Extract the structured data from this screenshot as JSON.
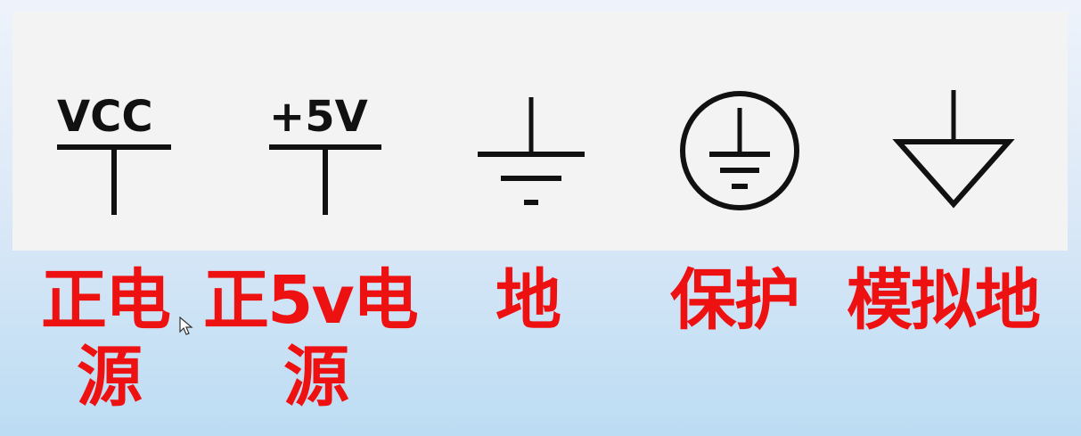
{
  "symbols": [
    {
      "id": "vcc",
      "label": "VCC",
      "caption": [
        "正电",
        "源"
      ]
    },
    {
      "id": "plus5v",
      "label": "+5V",
      "caption": [
        "正5v电",
        "源"
      ]
    },
    {
      "id": "ground",
      "caption": [
        "地"
      ]
    },
    {
      "id": "protective-earth",
      "caption": [
        "保护"
      ]
    },
    {
      "id": "analog-ground",
      "caption": [
        "模拟地"
      ]
    }
  ],
  "colors": {
    "caption": "#ee1111",
    "symbol": "#111111",
    "panel": "#f3f3f3"
  },
  "icons": [
    "mouse-cursor-icon"
  ]
}
